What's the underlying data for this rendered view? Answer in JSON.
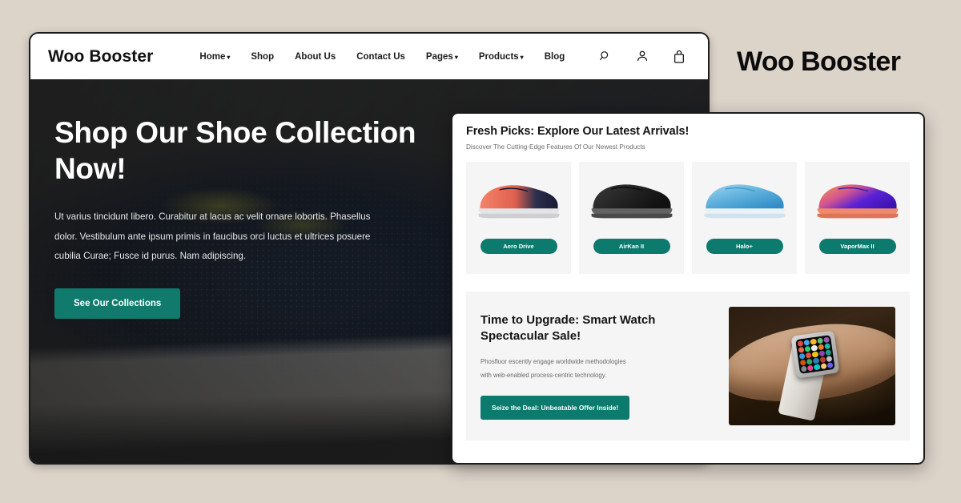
{
  "page": {
    "background_color": "#dcd3c9",
    "accent_color": "#0d7a6e",
    "side_title": "Woo Booster"
  },
  "browser": {
    "header": {
      "logo": "Woo Booster",
      "nav": [
        {
          "label": "Home",
          "has_dropdown": true
        },
        {
          "label": "Shop",
          "has_dropdown": false
        },
        {
          "label": "About Us",
          "has_dropdown": false
        },
        {
          "label": "Contact Us",
          "has_dropdown": false
        },
        {
          "label": "Pages",
          "has_dropdown": true
        },
        {
          "label": "Products",
          "has_dropdown": true
        },
        {
          "label": "Blog",
          "has_dropdown": false
        }
      ],
      "icons": [
        "search-icon",
        "account-icon",
        "cart-bag-icon"
      ]
    },
    "hero": {
      "title": "Shop Our Shoe Collection Now!",
      "description": "Ut varius tincidunt libero. Curabitur at lacus ac velit ornare lobortis. Phasellus dolor. Vestibulum ante ipsum primis in faucibus orci luctus et ultrices posuere cubilia Curae; Fusce id purus. Nam adipiscing.",
      "cta_label": "See Our Collections"
    }
  },
  "overlay": {
    "title": "Fresh Picks: Explore Our Latest Arrivals!",
    "subtitle": "Discover The Cutting-Edge Features Of Our Newest Products",
    "products": [
      {
        "name": "Aero Drive",
        "colors": [
          "#f0705a",
          "#1c2340"
        ]
      },
      {
        "name": "AirKan II",
        "colors": [
          "#2a2a2a",
          "#101010"
        ]
      },
      {
        "name": "Halo+",
        "colors": [
          "#7fc4e8",
          "#2f8fc4"
        ]
      },
      {
        "name": "VaporMax II",
        "colors": [
          "#e87a55",
          "#4416c8"
        ]
      }
    ],
    "promo": {
      "title": "Time to Upgrade: Smart Watch Spectacular Sale!",
      "description_line1": "Phosfluor escently engage worldwide methodologies",
      "description_line2": "with web-enabled process-centric technology.",
      "cta_label": "Seize the Deal: Unbeatable Offer Inside!",
      "image_alt": "smartwatch-on-wrist-photo"
    }
  }
}
